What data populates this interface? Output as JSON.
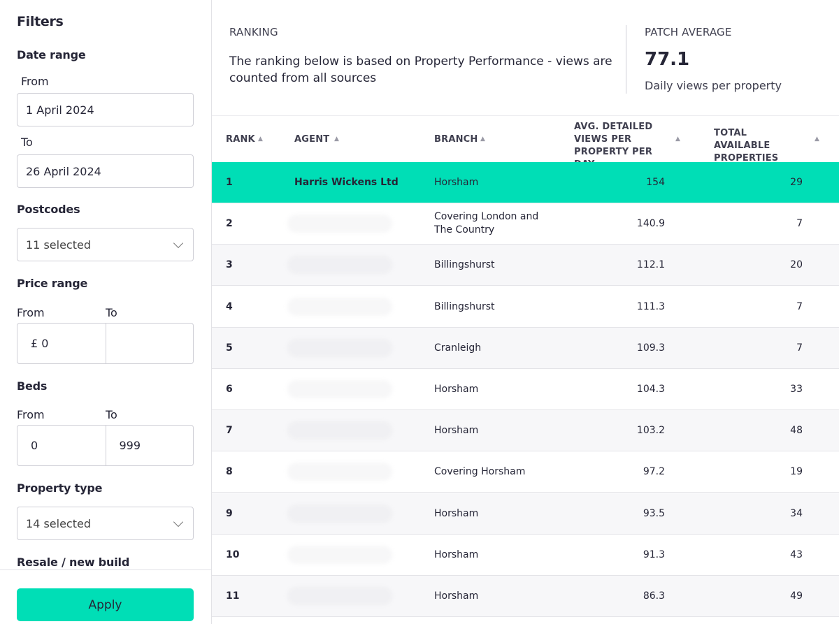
{
  "filters": {
    "title": "Filters",
    "date_range": {
      "label": "Date range",
      "from_label": "From",
      "from_value": "1 April 2024",
      "to_label": "To",
      "to_value": "26 April 2024"
    },
    "postcodes": {
      "label": "Postcodes",
      "value": "11 selected"
    },
    "price_range": {
      "label": "Price range",
      "from_label": "From",
      "to_label": "To",
      "from_value": "£ 0",
      "to_value": ""
    },
    "beds": {
      "label": "Beds",
      "from_label": "From",
      "to_label": "To",
      "from_value": "0",
      "to_value": "999"
    },
    "property_type": {
      "label": "Property type",
      "value": "14 selected"
    },
    "resale": {
      "label": "Resale / new build"
    },
    "apply_label": "Apply"
  },
  "summary": {
    "ranking_heading": "RANKING",
    "ranking_description": "The ranking below is based on Property Performance - views are counted from all sources",
    "patch_heading": "PATCH AVERAGE",
    "patch_value": "77.1",
    "patch_subtitle": "Daily views per property"
  },
  "table": {
    "columns": {
      "rank": "RANK",
      "agent": "AGENT",
      "branch": "BRANCH",
      "avg": "AVG. DETAILED VIEWS PER PROPERTY PER DAY",
      "total": "TOTAL AVAILABLE PROPERTIES"
    },
    "sort_icon": "▲",
    "rows": [
      {
        "rank": "1",
        "agent": "Harris Wickens Ltd",
        "branch": "Horsham",
        "avg": "154",
        "total": "29",
        "highlight": true
      },
      {
        "rank": "2",
        "agent": "",
        "branch": "Covering London and The Country",
        "avg": "140.9",
        "total": "7"
      },
      {
        "rank": "3",
        "agent": "",
        "branch": "Billingshurst",
        "avg": "112.1",
        "total": "20"
      },
      {
        "rank": "4",
        "agent": "",
        "branch": "Billingshurst",
        "avg": "111.3",
        "total": "7"
      },
      {
        "rank": "5",
        "agent": "",
        "branch": "Cranleigh",
        "avg": "109.3",
        "total": "7"
      },
      {
        "rank": "6",
        "agent": "",
        "branch": "Horsham",
        "avg": "104.3",
        "total": "33"
      },
      {
        "rank": "7",
        "agent": "",
        "branch": "Horsham",
        "avg": "103.2",
        "total": "48"
      },
      {
        "rank": "8",
        "agent": "",
        "branch": "Covering Horsham",
        "avg": "97.2",
        "total": "19"
      },
      {
        "rank": "9",
        "agent": "",
        "branch": "Horsham",
        "avg": "93.5",
        "total": "34"
      },
      {
        "rank": "10",
        "agent": "",
        "branch": "Horsham",
        "avg": "91.3",
        "total": "43"
      },
      {
        "rank": "11",
        "agent": "",
        "branch": "Horsham",
        "avg": "86.3",
        "total": "49"
      }
    ]
  }
}
